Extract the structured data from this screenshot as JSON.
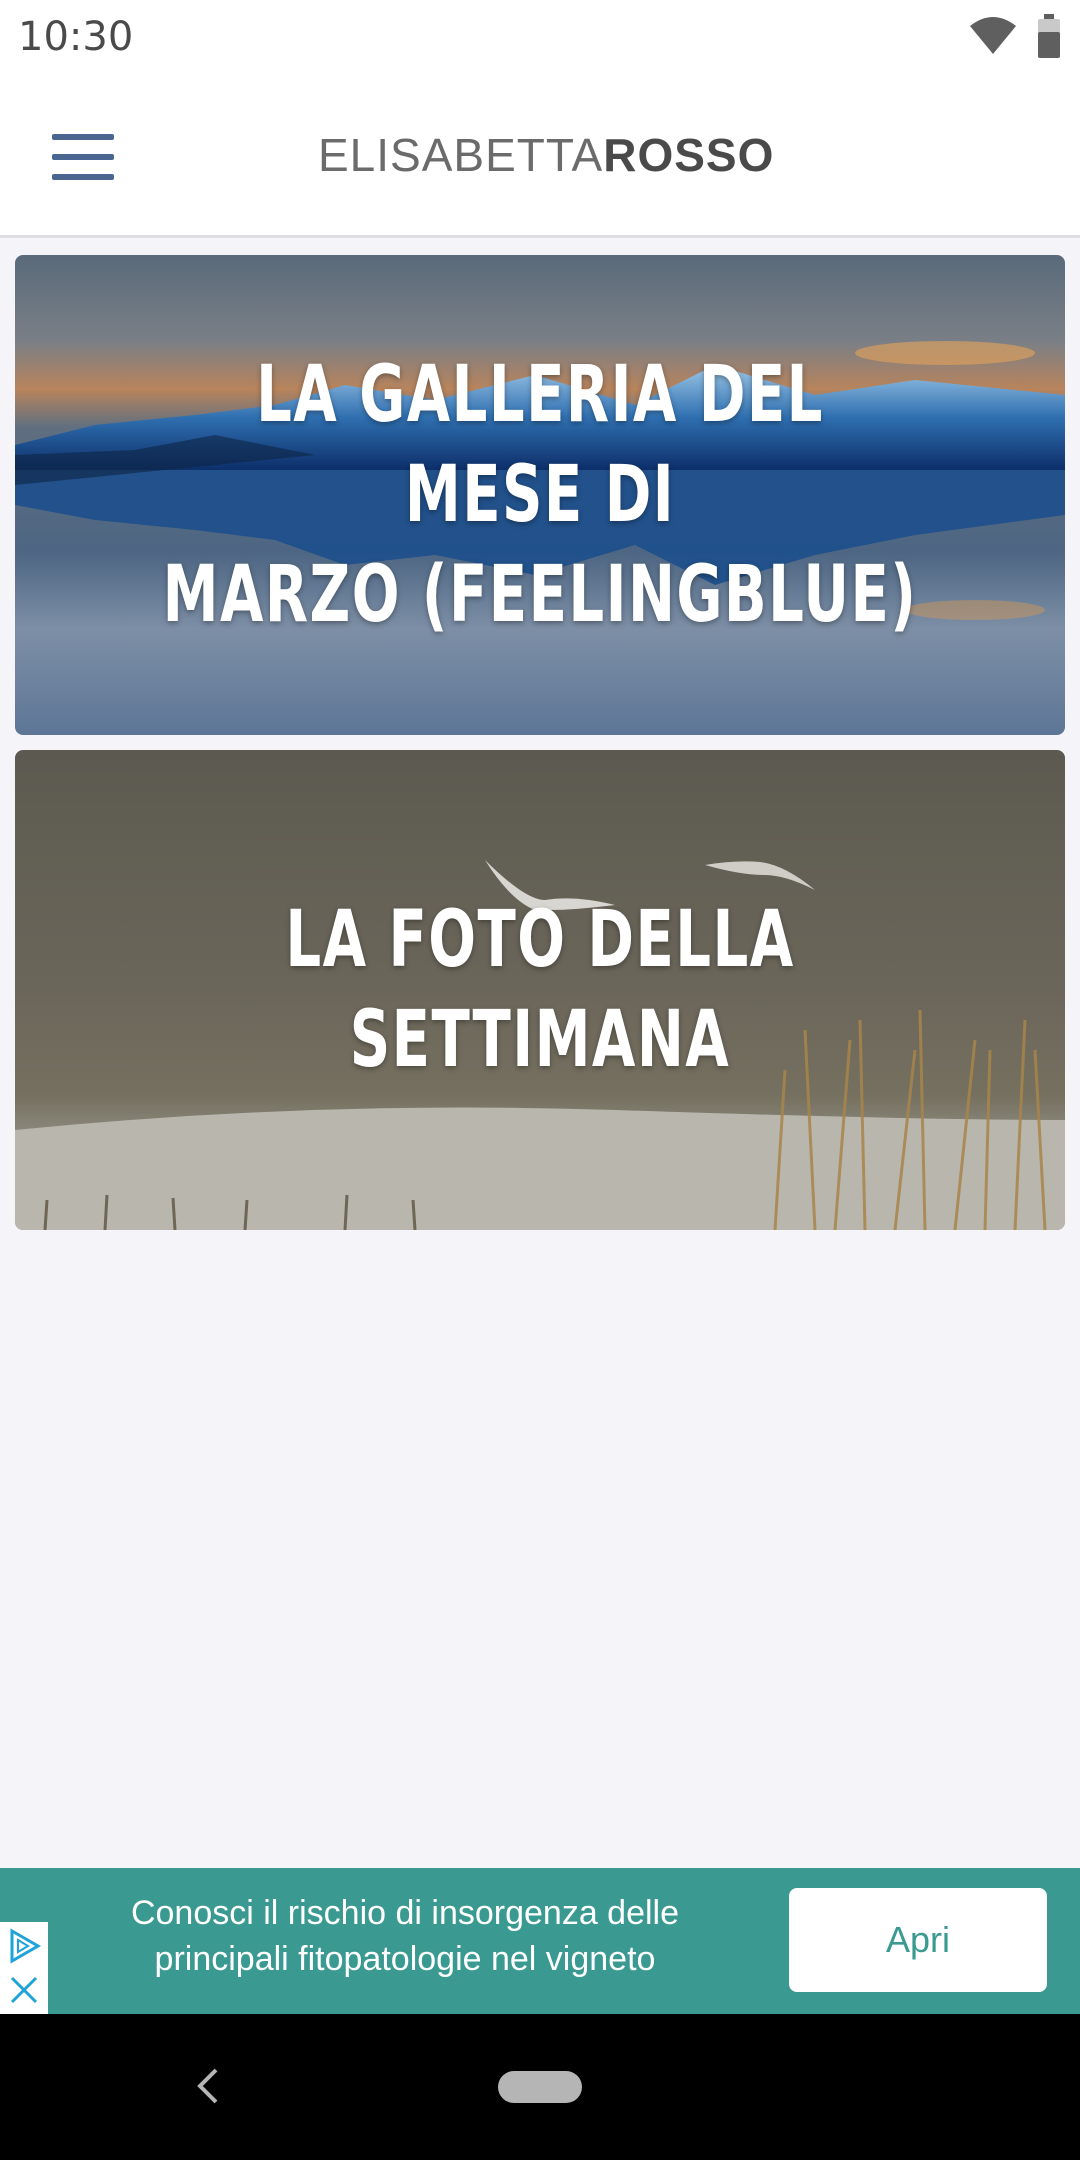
{
  "status_bar": {
    "time": "10:30",
    "icons": [
      "wifi-icon",
      "battery-icon"
    ]
  },
  "app_bar": {
    "brand_light": "ELISABETTA",
    "brand_bold": "ROSSO",
    "menu_icon": "hamburger-menu-icon"
  },
  "cards": [
    {
      "title_line1": "LA GALLERIA DEL MESE DI",
      "title_line2": "MARZO (FEELINGBLUE)"
    },
    {
      "title_line1": "LA FOTO DELLA SETTIMANA"
    }
  ],
  "ad": {
    "text_line1": "Conosci il rischio di insorgenza delle",
    "text_line2": "principali fitopatologie nel vigneto",
    "button_label": "Apri",
    "color": "#3a9a91",
    "icons": [
      "ad-choices-icon",
      "close-icon"
    ]
  },
  "nav_bar": {
    "icons": [
      "back-icon",
      "home-pill"
    ]
  }
}
